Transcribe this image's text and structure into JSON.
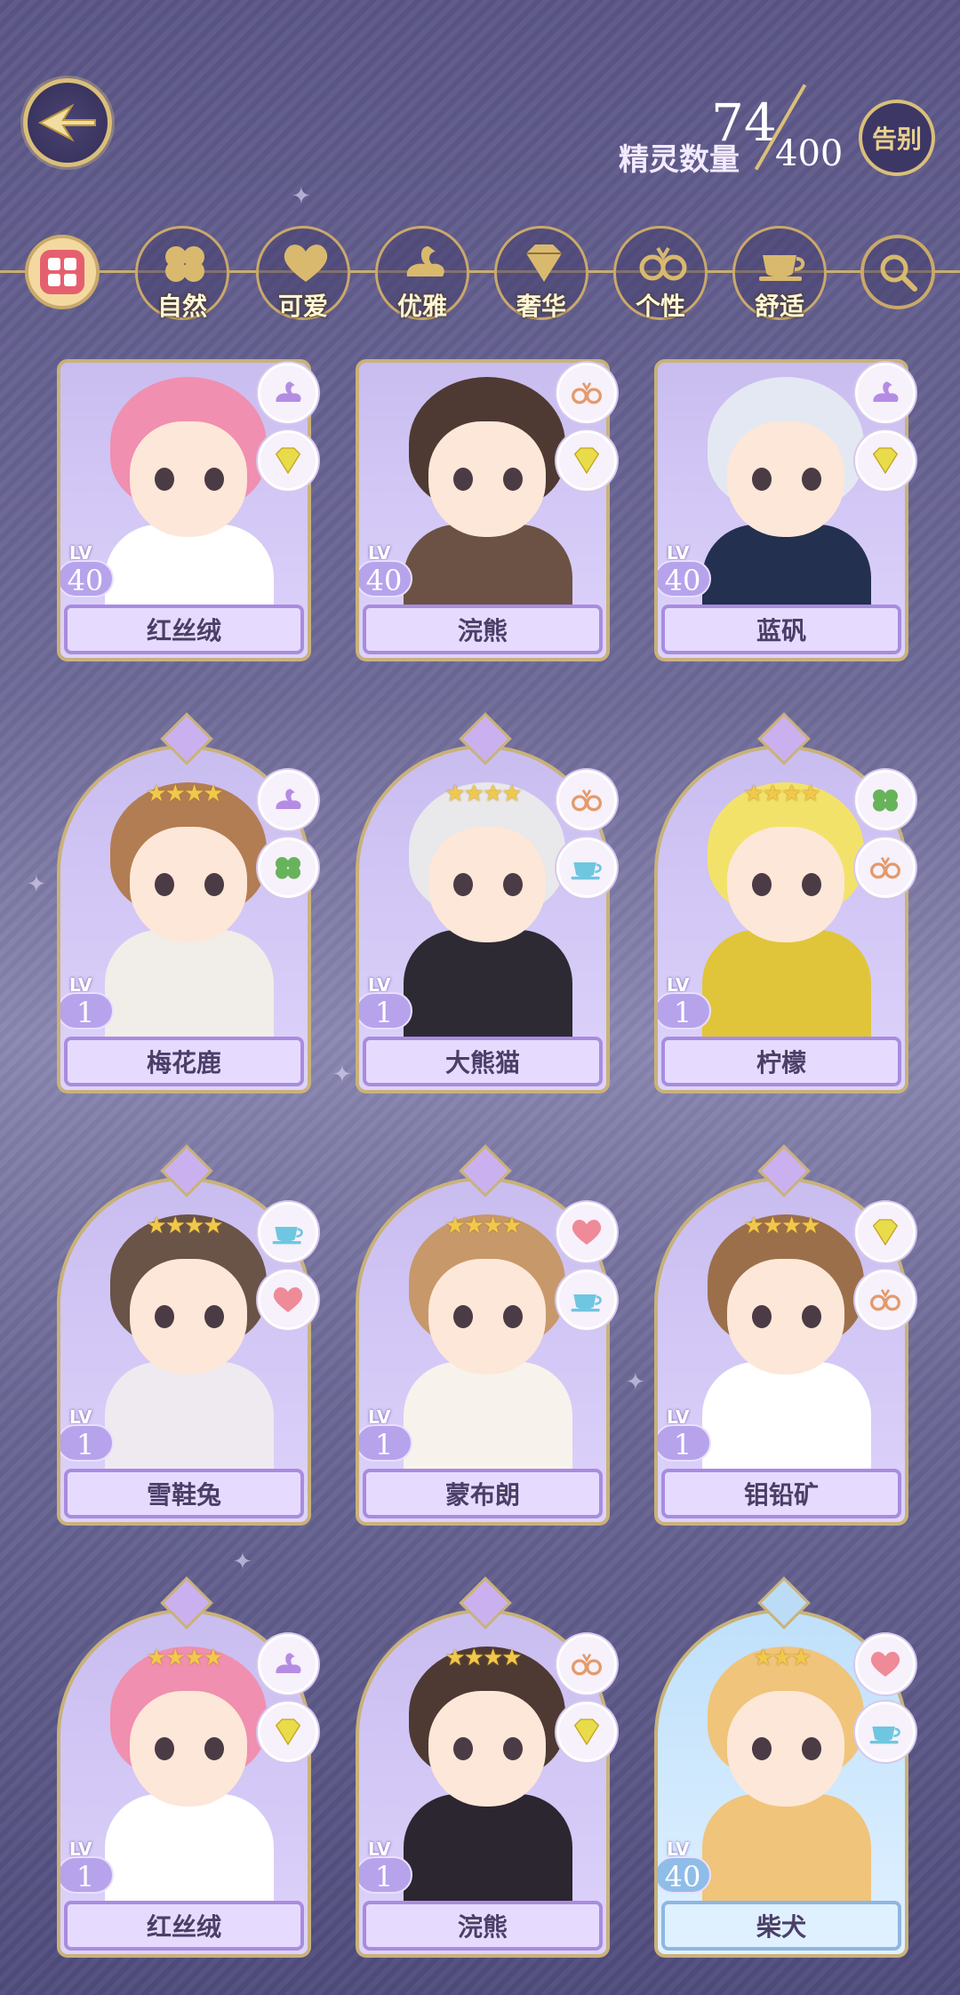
{
  "header": {
    "count_label": "精灵数量",
    "count_current": "74",
    "count_max": "400",
    "farewell_label": "告别"
  },
  "filters": [
    {
      "label": "自然",
      "icon": "clover-icon"
    },
    {
      "label": "可爱",
      "icon": "heart-icon"
    },
    {
      "label": "优雅",
      "icon": "swan-icon"
    },
    {
      "label": "奢华",
      "icon": "diamond-icon"
    },
    {
      "label": "个性",
      "icon": "glasses-icon"
    },
    {
      "label": "舒适",
      "icon": "teacup-icon"
    }
  ],
  "cards": [
    {
      "name": "红丝绒",
      "lv_label": "LV",
      "level": "40",
      "stars": "",
      "badges": [
        "swan-icon",
        "diamond-icon"
      ],
      "hair": "#f08fb0",
      "body": "#ffffff"
    },
    {
      "name": "浣熊",
      "lv_label": "LV",
      "level": "40",
      "stars": "",
      "badges": [
        "glasses-icon",
        "diamond-icon"
      ],
      "hair": "#4e3a33",
      "body": "#6b5244"
    },
    {
      "name": "蓝矾",
      "lv_label": "LV",
      "level": "40",
      "stars": "",
      "badges": [
        "swan-icon",
        "diamond-icon"
      ],
      "hair": "#e4e8f2",
      "body": "#24304f"
    },
    {
      "name": "梅花鹿",
      "lv_label": "LV",
      "level": "1",
      "stars": "★★★★",
      "badges": [
        "swan-icon",
        "clover-icon"
      ],
      "hair": "#b27d52",
      "body": "#f1ede8"
    },
    {
      "name": "大熊猫",
      "lv_label": "LV",
      "level": "1",
      "stars": "★★★★",
      "badges": [
        "glasses-icon",
        "teacup-icon"
      ],
      "hair": "#e9e8ea",
      "body": "#2d2a33"
    },
    {
      "name": "柠檬",
      "lv_label": "LV",
      "level": "1",
      "stars": "★★★★",
      "badges": [
        "clover-icon",
        "glasses-icon"
      ],
      "hair": "#f3e26a",
      "body": "#e0c53a"
    },
    {
      "name": "雪鞋兔",
      "lv_label": "LV",
      "level": "1",
      "stars": "★★★★",
      "badges": [
        "teacup-icon",
        "heart-icon"
      ],
      "hair": "#6a5347",
      "body": "#eeeaf0"
    },
    {
      "name": "蒙布朗",
      "lv_label": "LV",
      "level": "1",
      "stars": "★★★★",
      "badges": [
        "heart-icon",
        "teacup-icon"
      ],
      "hair": "#c7986a",
      "body": "#f7f3ec"
    },
    {
      "name": "钼铅矿",
      "lv_label": "LV",
      "level": "1",
      "stars": "★★★★",
      "badges": [
        "diamond-icon",
        "glasses-icon"
      ],
      "hair": "#9c6f4b",
      "body": "#ffffff"
    },
    {
      "name": "红丝绒",
      "lv_label": "LV",
      "level": "1",
      "stars": "★★★★",
      "badges": [
        "swan-icon",
        "diamond-icon"
      ],
      "hair": "#f08fb0",
      "body": "#ffffff"
    },
    {
      "name": "浣熊",
      "lv_label": "LV",
      "level": "1",
      "stars": "★★★★",
      "badges": [
        "glasses-icon",
        "diamond-icon"
      ],
      "hair": "#4e3a33",
      "body": "#2b2630"
    },
    {
      "name": "柴犬",
      "lv_label": "LV",
      "level": "40",
      "stars": "★★★",
      "badges": [
        "heart-icon",
        "teacup-icon"
      ],
      "hair": "#f0c47a",
      "body": "#f0c47a",
      "theme": "blue"
    }
  ],
  "colors": {
    "gold": "#c9ad6d",
    "card_purple": "#ddd3fb",
    "card_blue": "#dff0ff"
  }
}
